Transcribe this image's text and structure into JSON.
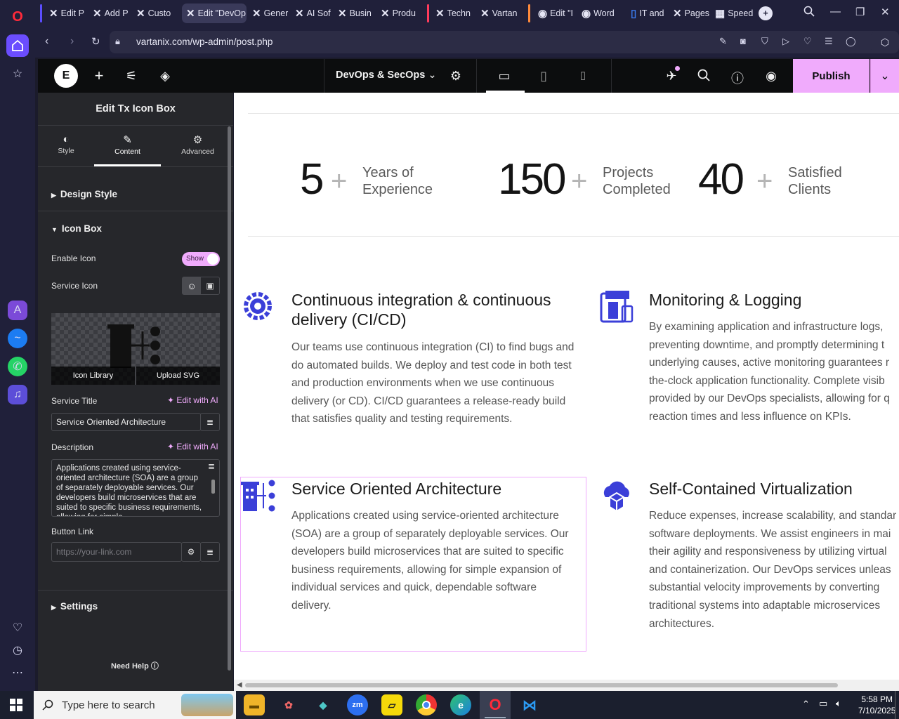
{
  "browser": {
    "url": "vartanix.com/wp-admin/post.php",
    "tabs": [
      {
        "label": "Edit P"
      },
      {
        "label": "Add P"
      },
      {
        "label": "Custo"
      },
      {
        "label": "Edit \"DevOp"
      },
      {
        "label": "Gener"
      },
      {
        "label": "AI Sof"
      },
      {
        "label": "Busin"
      },
      {
        "label": "Produ"
      },
      {
        "label": "Techn"
      },
      {
        "label": "Vartan"
      },
      {
        "label": "Edit \"I"
      },
      {
        "label": "Word"
      },
      {
        "label": "IT and"
      },
      {
        "label": "Pages"
      },
      {
        "label": "Speed"
      }
    ],
    "new_tab_symbol": "+"
  },
  "topbar": {
    "page_title": "DevOps & SecOps",
    "publish_label": "Publish"
  },
  "panel": {
    "title": "Edit Tx Icon Box",
    "tabs": [
      {
        "label": "Style"
      },
      {
        "label": "Content"
      },
      {
        "label": "Advanced"
      }
    ],
    "sections": {
      "design_style": "Design Style",
      "icon_box": "Icon Box",
      "settings": "Settings"
    },
    "enable_icon_label": "Enable Icon",
    "enable_icon_toggle": "Show",
    "service_icon_label": "Service Icon",
    "icon_library_label": "Icon Library",
    "upload_svg_label": "Upload SVG",
    "service_title_label": "Service Title",
    "edit_with_ai": "Edit with AI",
    "service_title_value": "Service Oriented Architecture",
    "description_label": "Description",
    "description_value": "Applications created using service-oriented architecture (SOA) are a group of separately deployable services. Our developers build microservices that are suited to specific business requirements, allowing for simple",
    "button_link_label": "Button Link",
    "button_link_placeholder": "https://your-link.com",
    "need_help": "Need Help"
  },
  "canvas": {
    "stats": [
      {
        "number": "5",
        "plus": "+",
        "label_line1": "Years of",
        "label_line2": "Experience"
      },
      {
        "number": "150",
        "plus": "+",
        "label_line1": "Projects",
        "label_line2": "Completed"
      },
      {
        "number": "40",
        "plus": "+",
        "label_line1": "Satisfied",
        "label_line2": "Clients"
      }
    ],
    "cards": [
      {
        "title_line1": "Continuous integration & continuous",
        "title_line2": "delivery (CI/CD)",
        "desc": [
          "Our teams use continuous integration (CI) to find bugs and",
          "do automated builds. We deploy and test code in both test",
          "and production environments when we use continuous",
          "delivery (or CD). CI/CD guarantees a release-ready build",
          "that satisfies quality and testing requirements."
        ]
      },
      {
        "title_line1": "Monitoring & Logging",
        "desc": [
          "By examining application and infrastructure logs,",
          "preventing downtime, and promptly determining t",
          "underlying causes, active monitoring guarantees r",
          "the-clock application functionality. Complete visib",
          "provided by our DevOps specialists, allowing for q",
          "reaction times and less influence on KPIs."
        ]
      },
      {
        "title_line1": "Service Oriented Architecture",
        "desc": [
          "Applications created using service-oriented architecture",
          "(SOA) are a group of separately deployable services. Our",
          "developers build microservices that are suited to specific",
          "business requirements, allowing for simple expansion of",
          "individual services and quick, dependable software",
          "delivery."
        ]
      },
      {
        "title_line1": "Self-Contained Virtualization",
        "desc": [
          "Reduce expenses, increase scalability, and standar",
          "software deployments. We assist engineers in mai",
          "their agility and responsiveness by utilizing virtual",
          "and containerization. Our DevOps services unleas",
          "substantial velocity improvements by converting",
          "traditional systems into adaptable microservices",
          "architectures."
        ]
      }
    ]
  },
  "taskbar": {
    "search_placeholder": "Type here to search",
    "time": "5:58 PM",
    "date": "7/10/2025"
  },
  "colors": {
    "accent_pink": "#f0abfc",
    "icon_blue": "#3b3fd8",
    "panel_bg": "#26272b"
  }
}
